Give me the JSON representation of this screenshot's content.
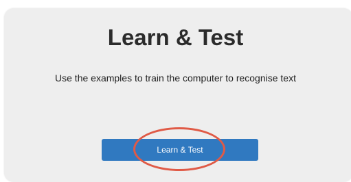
{
  "card": {
    "title": "Learn & Test",
    "description": "Use the examples to train the computer to recognise text",
    "button_label": "Learn & Test"
  },
  "colors": {
    "card_background": "#eeeeee",
    "button": "#3079c0",
    "highlight": "#e05a46"
  }
}
